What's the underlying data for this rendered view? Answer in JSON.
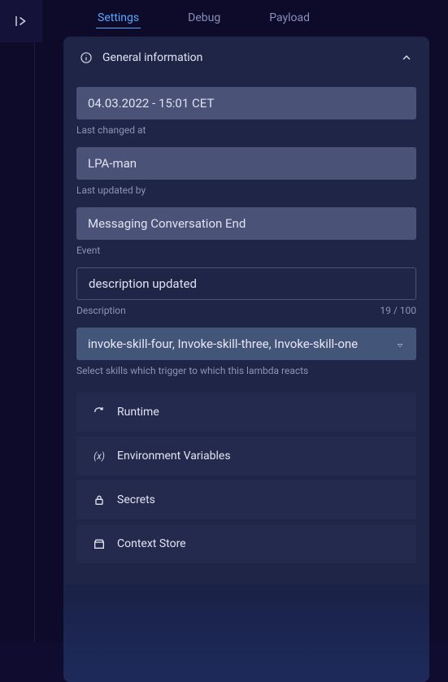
{
  "tabs": {
    "settings": "Settings",
    "debug": "Debug",
    "payload": "Payload"
  },
  "general": {
    "title": "General information",
    "last_changed_value": "04.03.2022 - 15:01 CET",
    "last_changed_label": "Last changed at",
    "last_updated_by_value": "LPA-man",
    "last_updated_by_label": "Last updated by",
    "event_value": "Messaging Conversation End",
    "event_label": "Event",
    "description_value": "description updated",
    "description_label": "Description",
    "description_count": "19 / 100",
    "skills_value": "invoke-skill-four, Invoke-skill-three, Invoke-skill-one",
    "skills_helper": "Select skills which trigger to which this lambda reacts"
  },
  "accordions": {
    "runtime": "Runtime",
    "env": "Environment Variables",
    "secrets": "Secrets",
    "context": "Context Store"
  }
}
